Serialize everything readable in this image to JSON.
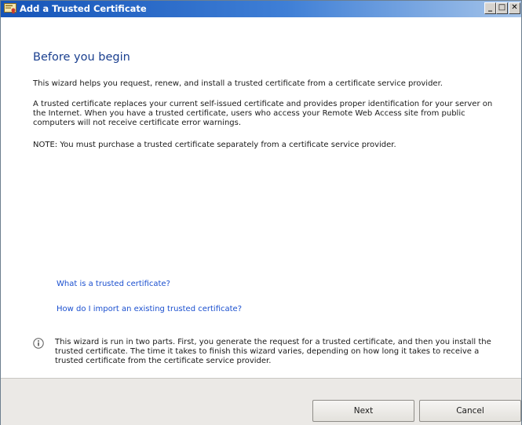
{
  "window": {
    "title": "Add a Trusted Certificate",
    "controls": {
      "minimize": "_",
      "maximize": "□",
      "close": "✕"
    }
  },
  "main": {
    "heading": "Before you begin",
    "paragraphs": [
      "This wizard helps you request, renew, and install a trusted certificate from a certificate service provider.",
      "A trusted certificate replaces your current self-issued certificate and provides proper identification for your server on the Internet. When you have a trusted certificate, users who access your Remote Web Access site from public computers will not receive certificate error warnings.",
      "NOTE: You must purchase a trusted certificate separately from a certificate service provider."
    ],
    "links": [
      "What is a trusted certificate?",
      "How do I import an existing trusted certificate?"
    ],
    "info_text": "This wizard is run in two parts. First, you generate the request for a trusted certificate, and then you install the trusted certificate. The time it takes to finish this wizard varies, depending on how long it takes to receive a trusted certificate from the certificate service provider.",
    "info_icon": "info-icon"
  },
  "footer": {
    "next_label": "Next",
    "cancel_label": "Cancel"
  },
  "colors": {
    "titlebar": "#1554b8",
    "heading": "#1a3f8f",
    "link": "#1a4fcf",
    "footer_bg": "#ebe9e6"
  }
}
